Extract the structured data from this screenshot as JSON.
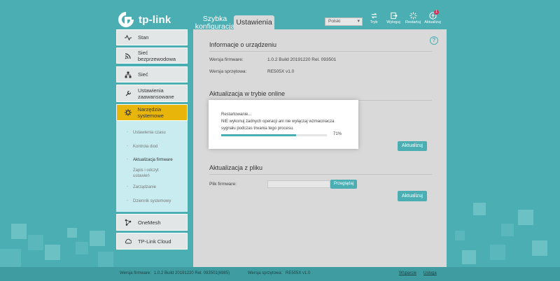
{
  "brand": {
    "logo_text": "tp-link"
  },
  "header": {
    "tab_quick_line1": "Szybka",
    "tab_quick_line2": "konfiguracja",
    "tab_settings": "Ustawienia",
    "language_selected": "Polski",
    "tools": [
      {
        "label": "Tryb",
        "icon": "mode-icon"
      },
      {
        "label": "Wyloguj",
        "icon": "logout-icon"
      },
      {
        "label": "Restartuj",
        "icon": "reboot-icon"
      },
      {
        "label": "Aktualizuj",
        "icon": "update-icon",
        "badge": "1"
      }
    ]
  },
  "sidebar": {
    "items": [
      {
        "label": "Stan",
        "icon": "status-icon"
      },
      {
        "label": "Sieć bezprzewodowa",
        "icon": "wifi-icon"
      },
      {
        "label": "Sieć",
        "icon": "network-icon"
      },
      {
        "label": "Ustawienia zaawansowane",
        "icon": "advanced-settings-icon"
      },
      {
        "label": "Narzędzia systemowe",
        "icon": "system-tools-icon"
      },
      {
        "label": "OneMesh",
        "icon": "onemesh-icon"
      },
      {
        "label": "TP-Link Cloud",
        "icon": "cloud-icon"
      }
    ],
    "sub_items": [
      "Ustawienia czasu",
      "Kontrola diod",
      "Aktualizacja firmware",
      "Zapis i odczyt ustawień",
      "Zarządzanie",
      "Dziennik systemowy"
    ]
  },
  "main": {
    "device_info_title": "Informacje o urządzeniu",
    "firmware_label": "Wersja firmware:",
    "firmware_value": "1.0.2 Build 20191220 Rel. 093501",
    "hardware_label": "Wersja sprzętowa:",
    "hardware_value": "RE505X v1.0",
    "online_update_title": "Aktualizacja w trybie online",
    "update_button": "Aktualizuj",
    "file_update_title": "Aktualizacja z pliku",
    "file_label": "Plik firmware:",
    "browse_button": "Przeglądaj",
    "help": "?"
  },
  "modal": {
    "line1": "Restartowanie...",
    "line2": "NIE wykonuj żadnych operacji ani nie wyłączaj wzmacniacza",
    "line3": "sygnału podczas trwania tego procesu.",
    "progress_text": "71%",
    "progress_value": 0.71
  },
  "footer": {
    "firmware_label": "Wersja firmware:",
    "firmware_value": "1.0.2 Build 20191220 Rel. 093501(6985)",
    "hardware_label": "Wersja sprzętowa:",
    "hardware_value": "RE505X v1.0",
    "support": "Wsparcie",
    "services": "Usługa"
  },
  "colors": {
    "accent": "#4aaeb3",
    "active": "#e8b60b",
    "badge": "#d0355a"
  }
}
